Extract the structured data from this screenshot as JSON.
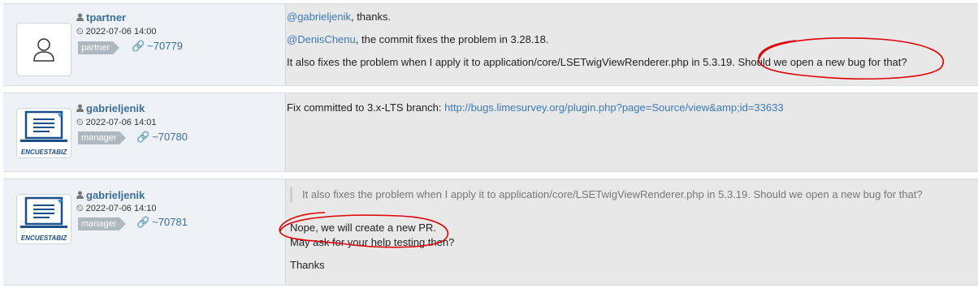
{
  "notes": [
    {
      "author": "tpartner",
      "date": "2022-07-06 14:00",
      "role": "partner",
      "note_id": "~70779",
      "avatar": "user-placeholder-icon",
      "lines": {
        "l1_mention": "@gabrieljenik",
        "l1_rest": ", thanks.",
        "l2_mention": "@DenisChenu",
        "l2_rest": ", the commit fixes the problem in 3.28.18.",
        "l3": "It also fixes the problem when I apply it to application/core/LSETwigViewRenderer.php in 5.3.19. Should we open a new bug for that?"
      }
    },
    {
      "author": "gabrieljenik",
      "date": "2022-07-06 14:01",
      "role": "manager",
      "note_id": "~70780",
      "avatar_label": "ENCUESTABIZ",
      "lines": {
        "l1_text": "Fix committed to 3.x-LTS branch: ",
        "l1_link": "http://bugs.limesurvey.org/plugin.php?page=Source/view&amp;id=33633"
      }
    },
    {
      "author": "gabrieljenik",
      "date": "2022-07-06 14:10",
      "role": "manager",
      "note_id": "~70781",
      "avatar_label": "ENCUESTABIZ",
      "quote": "It also fixes the problem when I apply it to application/core/LSETwigViewRenderer.php in 5.3.19. Should we open a new bug for that?",
      "lines": {
        "l1": "Nope, we will create a new PR.",
        "l2": "May ask for your help testing then?",
        "l3": "Thanks"
      }
    }
  ],
  "colors": {
    "link": "#3a7ab8",
    "author": "#3a6f9a",
    "role_bg": "#aeb8c1",
    "annotation": "#e00000"
  }
}
